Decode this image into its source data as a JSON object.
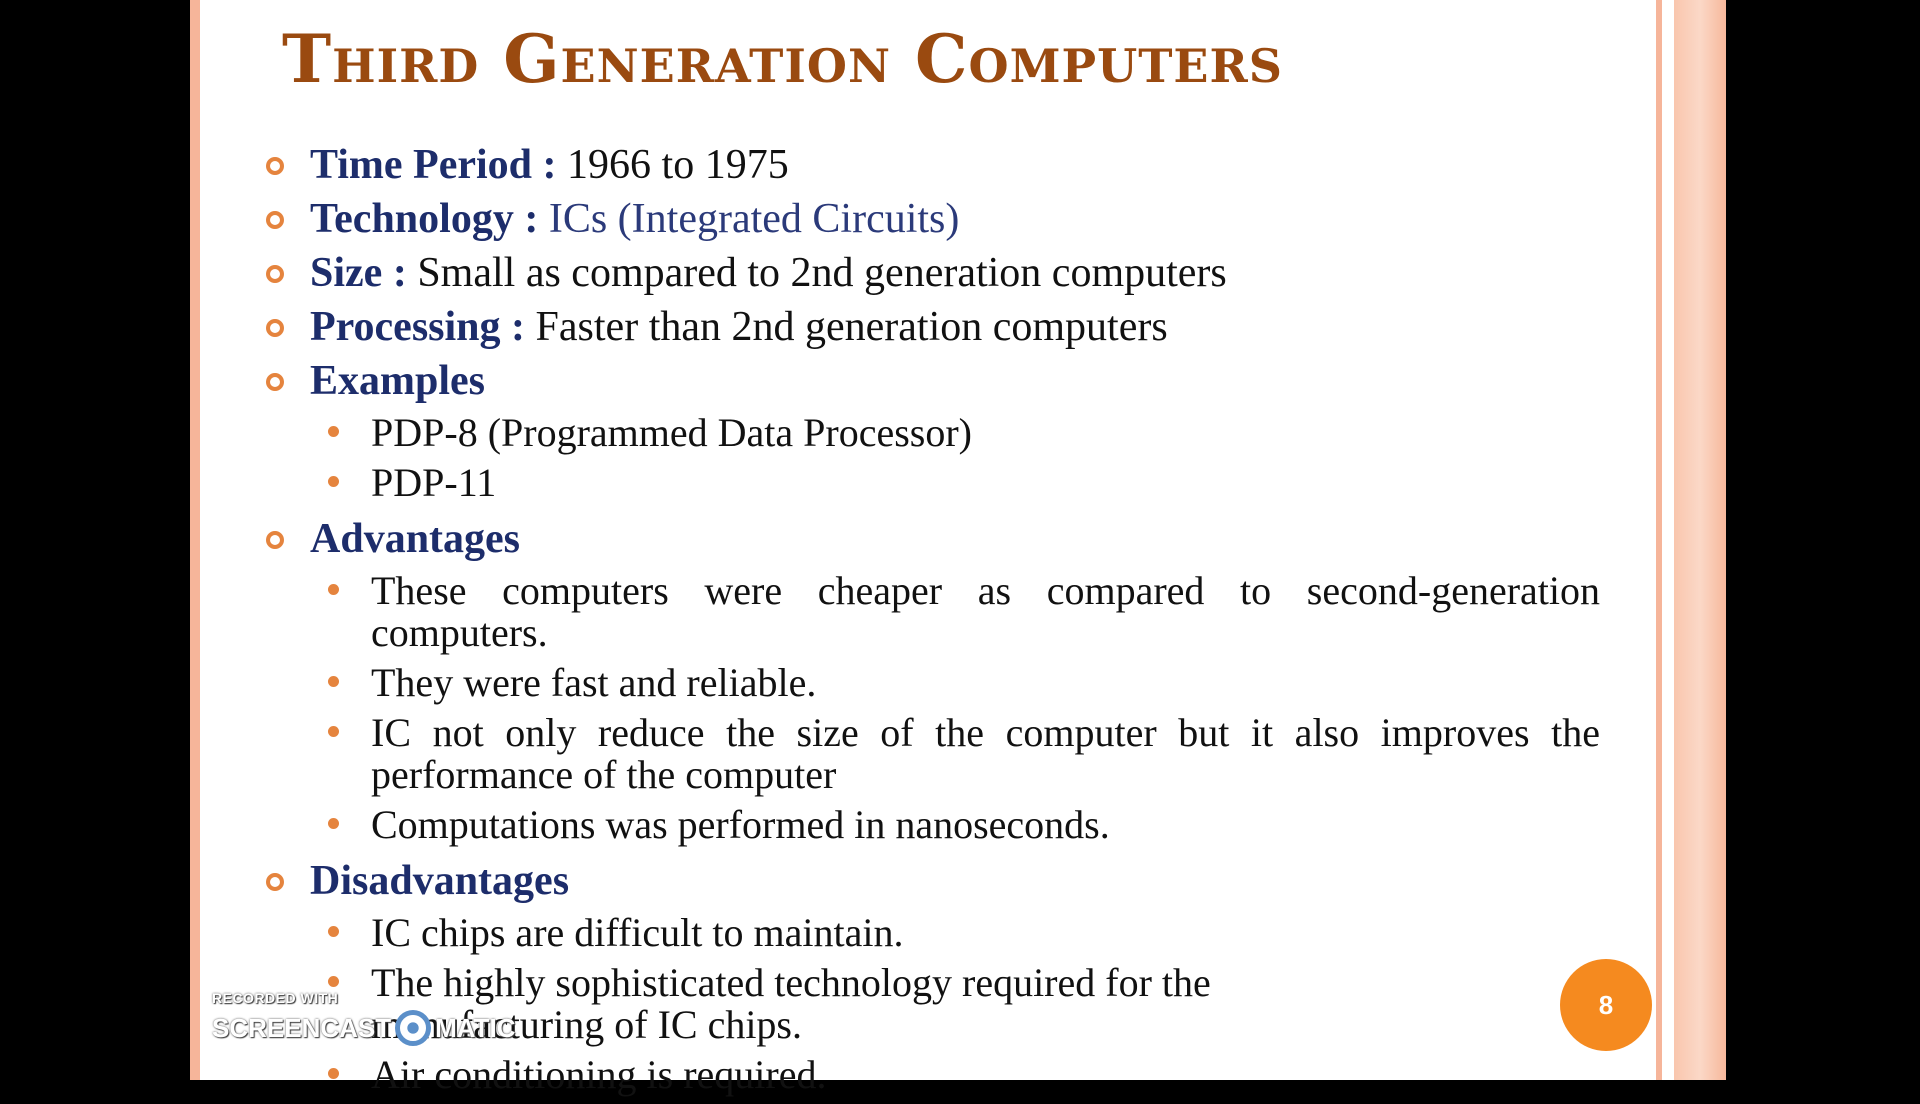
{
  "slide": {
    "title": "Third Generation Computers",
    "page_number": "8",
    "items": {
      "time_period": {
        "label": "Time Period",
        "sep": " : ",
        "value": "1966 to 1975"
      },
      "technology": {
        "label": "Technology",
        "sep": " : ",
        "value": "ICs (Integrated Circuits)"
      },
      "size": {
        "label": "Size",
        "sep": " : ",
        "value": "Small as compared to 2nd generation computers"
      },
      "processing": {
        "label": "Processing",
        "sep": " : ",
        "value": "Faster than 2nd generation computers"
      },
      "examples": {
        "label": "Examples",
        "sub": [
          "PDP-8 (Programmed Data Processor)",
          "PDP-11"
        ]
      },
      "advantages": {
        "label": "Advantages",
        "sub": [
          "These computers were cheaper as compared to second-generation computers.",
          "They were fast and reliable.",
          "IC not only reduce the size of the computer but it also improves the performance of the computer",
          "Computations  was performed in nanoseconds."
        ]
      },
      "disadvantages": {
        "label": "Disadvantages",
        "sub": [
          "IC chips are difficult to maintain.",
          "The highly sophisticated technology required for  the manufacturing of IC chips.",
          "Air conditioning is required."
        ]
      }
    }
  },
  "watermark": {
    "line1": "RECORDED WITH",
    "part1": "SCREENCAST",
    "part2": "MATIC"
  },
  "colors": {
    "title": "#9a4a10",
    "label": "#1d2d6b",
    "bullet": "#e5843e",
    "page_badge": "#f58a1f",
    "stripe": "#f6b59a"
  }
}
